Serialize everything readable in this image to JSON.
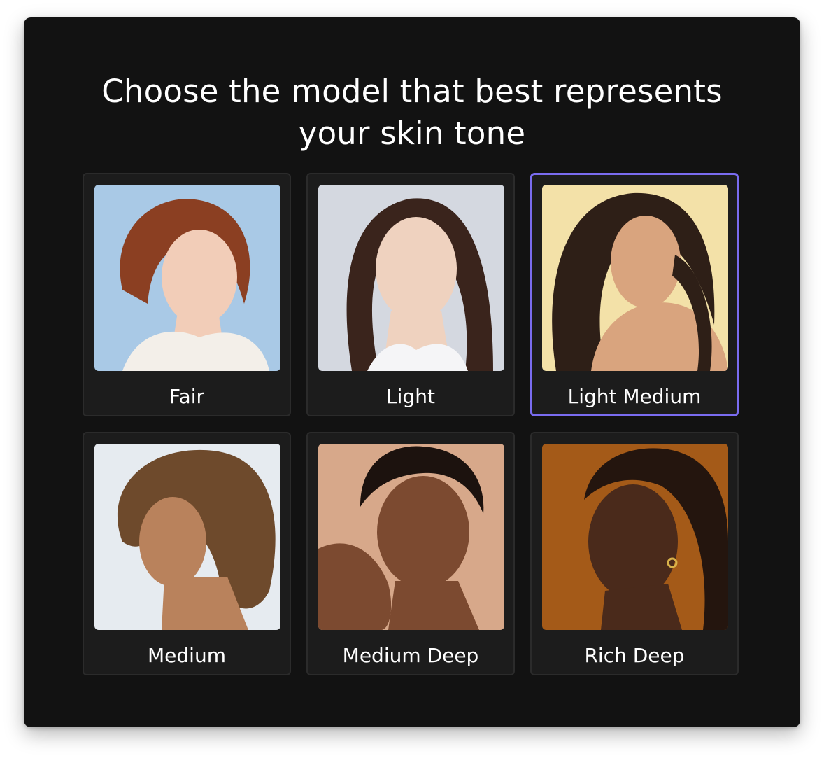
{
  "heading": {
    "line1": "Choose the model that best represents",
    "line2": "your skin tone"
  },
  "accent_color": "#7a6cf0",
  "selected_option": "Light Medium",
  "options": [
    {
      "label": "Fair",
      "selected": false,
      "background": "#a9c9e6",
      "skin": "#f2cdb8",
      "hair": "#8b3f22"
    },
    {
      "label": "Light",
      "selected": false,
      "background": "#d4d8e0",
      "skin": "#efd2bf",
      "hair": "#3a241c"
    },
    {
      "label": "Light Medium",
      "selected": true,
      "background": "#f3e1a8",
      "skin": "#d9a47e",
      "hair": "#2e1f17"
    },
    {
      "label": "Medium",
      "selected": false,
      "background": "#e6ebf0",
      "skin": "#b9825c",
      "hair": "#6e4a2c"
    },
    {
      "label": "Medium Deep",
      "selected": false,
      "background": "#d7a88a",
      "skin": "#7c4a30",
      "hair": "#1c120e"
    },
    {
      "label": "Rich Deep",
      "selected": false,
      "background": "#a45a18",
      "skin": "#4a2a1b",
      "hair": "#24150e"
    }
  ]
}
